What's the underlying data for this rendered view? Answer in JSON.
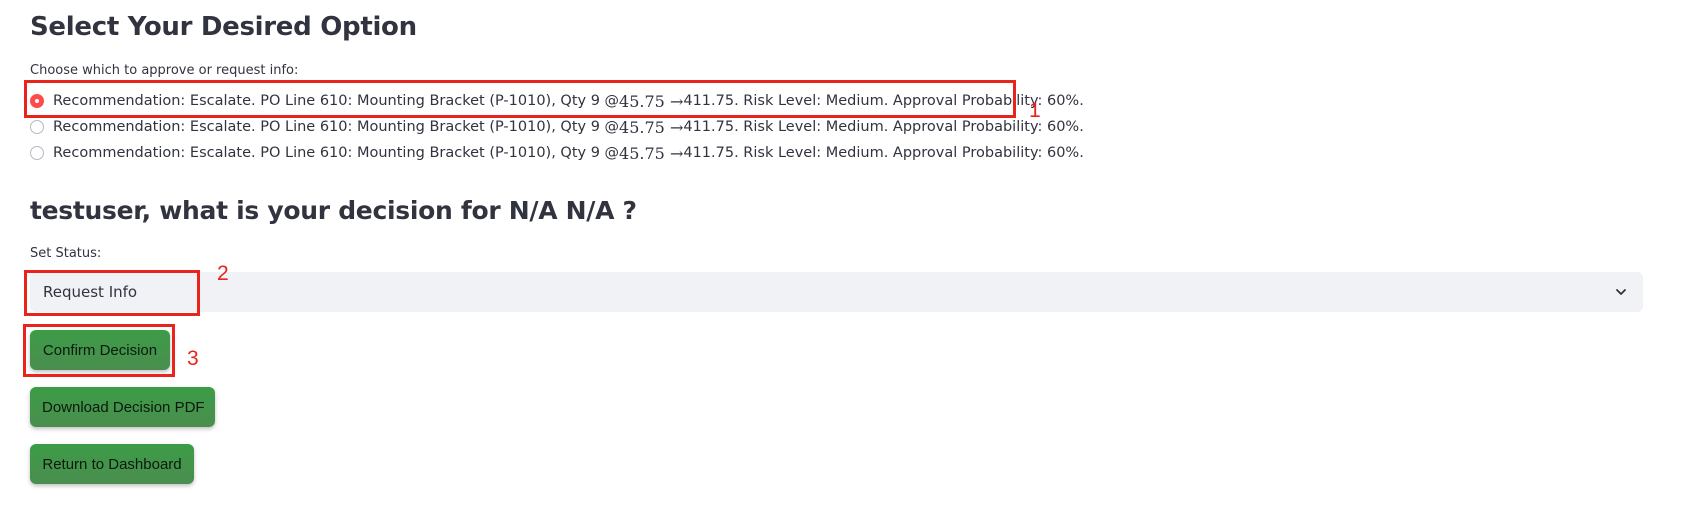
{
  "page": {
    "title": "Select Your Desired Option",
    "radio_prompt": "Choose which to approve or request info:"
  },
  "options": [
    {
      "pre": "Recommendation: Escalate. PO Line 610: Mounting Bracket (P-1010), Qty 9 @ ",
      "math": "45.75 →",
      "post": "411.75. Risk Level: Medium. Approval Probability: 60%.",
      "selected": true
    },
    {
      "pre": "Recommendation: Escalate. PO Line 610: Mounting Bracket (P-1010), Qty 9 @ ",
      "math": "45.75 →",
      "post": "411.75. Risk Level: Medium. Approval Probability: 60%.",
      "selected": false
    },
    {
      "pre": "Recommendation: Escalate. PO Line 610: Mounting Bracket (P-1010), Qty 9 @ ",
      "math": "45.75 →",
      "post": "411.75. Risk Level: Medium. Approval Probability: 60%.",
      "selected": false
    }
  ],
  "decision": {
    "heading": "testuser, what is your decision for N/A N/A ?",
    "status_label": "Set Status:",
    "status_value": "Request Info",
    "chevron_icon": "chevron-down-icon"
  },
  "buttons": {
    "confirm": "Confirm Decision",
    "download": "Download Decision PDF",
    "return": "Return to Dashboard"
  },
  "annotations": {
    "one": "1",
    "two": "2",
    "three": "3"
  },
  "colors": {
    "accent_red": "#ff4b4b",
    "annotation_red": "#e8241c",
    "button_green": "#3d9a46",
    "select_bg": "#f0f2f6"
  }
}
